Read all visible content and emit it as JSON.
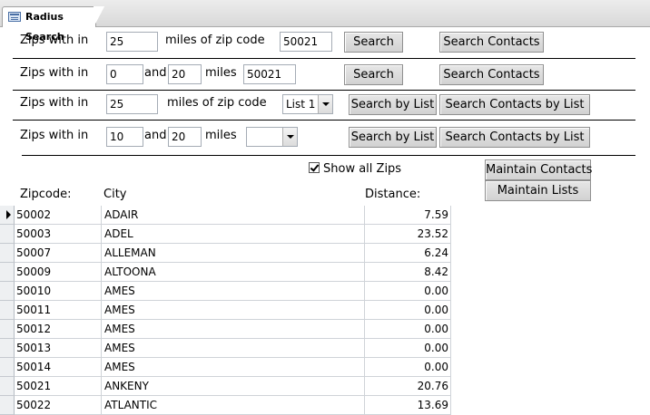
{
  "tab": {
    "title": "Radius Search"
  },
  "row1": {
    "label": "Zips with in",
    "miles_value": "25",
    "label2": "miles of zip code",
    "zip_value": "50021",
    "search_btn": "Search",
    "contacts_btn": "Search Contacts"
  },
  "row2": {
    "label": "Zips with in",
    "from_value": "0",
    "and_label": "and",
    "to_value": "20",
    "miles_label": "miles",
    "zip_value": "50021",
    "search_btn": "Search",
    "contacts_btn": "Search Contacts"
  },
  "row3": {
    "label": "Zips with in",
    "miles_value": "25",
    "label2": "miles of zip code",
    "list_value": "List 1",
    "search_btn": "Search by List",
    "contacts_btn": "Search Contacts by List"
  },
  "row4": {
    "label": "Zips with in",
    "from_value": "10",
    "and_label": "and",
    "to_value": "20",
    "miles_label": "miles",
    "list_value": "",
    "search_btn": "Search by List",
    "contacts_btn": "Search Contacts by List"
  },
  "options": {
    "show_all_label": "Show all Zips",
    "show_all_checked": true,
    "maintain_contacts_btn": "Maintain Contacts",
    "maintain_lists_btn": "Maintain Lists"
  },
  "columns": {
    "zip": "Zipcode:",
    "city": "City",
    "distance": "Distance:"
  },
  "records": [
    {
      "zip": "50002",
      "city": "ADAIR",
      "distance": "7.59"
    },
    {
      "zip": "50003",
      "city": "ADEL",
      "distance": "23.52"
    },
    {
      "zip": "50007",
      "city": "ALLEMAN",
      "distance": "6.24"
    },
    {
      "zip": "50009",
      "city": "ALTOONA",
      "distance": "8.42"
    },
    {
      "zip": "50010",
      "city": "AMES",
      "distance": "0.00"
    },
    {
      "zip": "50011",
      "city": "AMES",
      "distance": "0.00"
    },
    {
      "zip": "50012",
      "city": "AMES",
      "distance": "0.00"
    },
    {
      "zip": "50013",
      "city": "AMES",
      "distance": "0.00"
    },
    {
      "zip": "50014",
      "city": "AMES",
      "distance": "0.00"
    },
    {
      "zip": "50021",
      "city": "ANKENY",
      "distance": "20.76"
    },
    {
      "zip": "50022",
      "city": "ATLANTIC",
      "distance": "13.69"
    }
  ]
}
